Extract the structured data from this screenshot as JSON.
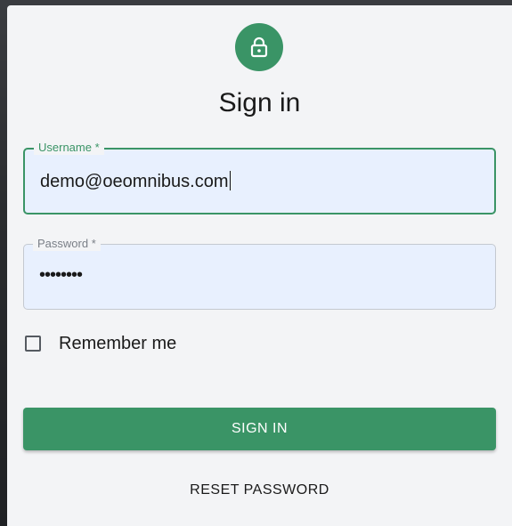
{
  "title": "Sign in",
  "icons": {
    "avatar": "lock-icon"
  },
  "colors": {
    "accent": "#3a9466",
    "field_bg": "#e8f0fe",
    "panel_bg": "#f3f4f6"
  },
  "form": {
    "username": {
      "label": "Username *",
      "value": "demo@oeomnibus.com"
    },
    "password": {
      "label": "Password *",
      "value": "••••••••"
    },
    "remember": {
      "label": "Remember me",
      "checked": false
    }
  },
  "buttons": {
    "sign_in": "SIGN IN",
    "reset_password": "RESET PASSWORD"
  }
}
